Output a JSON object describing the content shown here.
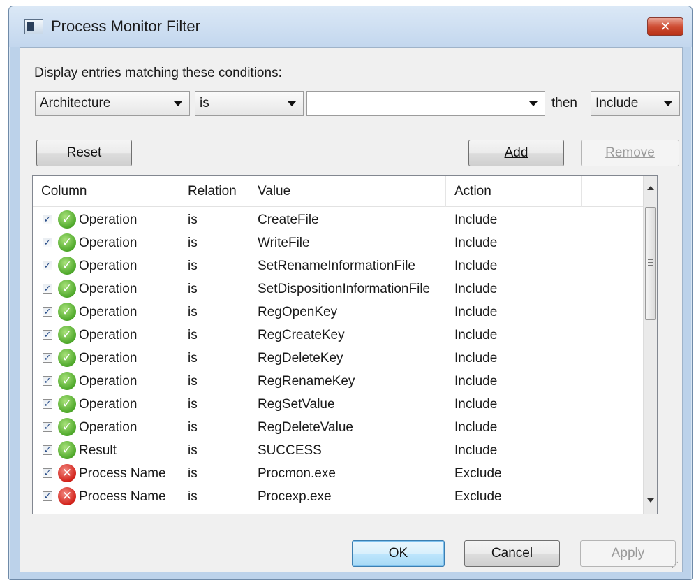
{
  "window": {
    "title": "Process Monitor Filter",
    "close_symbol": "✕"
  },
  "filter": {
    "instruction": "Display entries matching these conditions:",
    "column_value": "Architecture",
    "relation_value": "is",
    "value_value": "",
    "then_label": "then",
    "action_value": "Include"
  },
  "buttons": {
    "reset": "Reset",
    "add": "Add",
    "remove": "Remove",
    "ok": "OK",
    "cancel": "Cancel",
    "apply": "Apply"
  },
  "table": {
    "headers": [
      "Column",
      "Relation",
      "Value",
      "Action"
    ],
    "rows": [
      {
        "checked": true,
        "icon": "check-icon",
        "column": "Operation",
        "relation": "is",
        "value": "CreateFile",
        "action": "Include"
      },
      {
        "checked": true,
        "icon": "check-icon",
        "column": "Operation",
        "relation": "is",
        "value": "WriteFile",
        "action": "Include"
      },
      {
        "checked": true,
        "icon": "check-icon",
        "column": "Operation",
        "relation": "is",
        "value": "SetRenameInformationFile",
        "action": "Include"
      },
      {
        "checked": true,
        "icon": "check-icon",
        "column": "Operation",
        "relation": "is",
        "value": "SetDispositionInformationFile",
        "action": "Include"
      },
      {
        "checked": true,
        "icon": "check-icon",
        "column": "Operation",
        "relation": "is",
        "value": "RegOpenKey",
        "action": "Include"
      },
      {
        "checked": true,
        "icon": "check-icon",
        "column": "Operation",
        "relation": "is",
        "value": "RegCreateKey",
        "action": "Include"
      },
      {
        "checked": true,
        "icon": "check-icon",
        "column": "Operation",
        "relation": "is",
        "value": "RegDeleteKey",
        "action": "Include"
      },
      {
        "checked": true,
        "icon": "check-icon",
        "column": "Operation",
        "relation": "is",
        "value": "RegRenameKey",
        "action": "Include"
      },
      {
        "checked": true,
        "icon": "check-icon",
        "column": "Operation",
        "relation": "is",
        "value": "RegSetValue",
        "action": "Include"
      },
      {
        "checked": true,
        "icon": "check-icon",
        "column": "Operation",
        "relation": "is",
        "value": "RegDeleteValue",
        "action": "Include"
      },
      {
        "checked": true,
        "icon": "check-icon",
        "column": "Result",
        "relation": "is",
        "value": "SUCCESS",
        "action": "Include"
      },
      {
        "checked": true,
        "icon": "cross-icon",
        "column": "Process Name",
        "relation": "is",
        "value": "Procmon.exe",
        "action": "Exclude"
      },
      {
        "checked": true,
        "icon": "cross-icon",
        "column": "Process Name",
        "relation": "is",
        "value": "Procexp.exe",
        "action": "Exclude"
      }
    ]
  },
  "colors": {
    "include_icon": "#4ea82a",
    "exclude_icon": "#d2221a",
    "close_button": "#cf4d34"
  }
}
